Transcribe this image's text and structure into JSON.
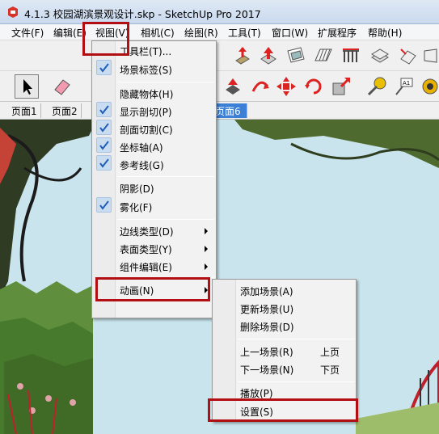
{
  "window": {
    "title": "4.1.3 校园湖滨景观设计.skp - SketchUp Pro 2017"
  },
  "menubar": {
    "items": [
      {
        "label": "文件(F)"
      },
      {
        "label": "编辑(E)"
      },
      {
        "label": "视图(V)"
      },
      {
        "label": "相机(C)"
      },
      {
        "label": "绘图(R)"
      },
      {
        "label": "工具(T)"
      },
      {
        "label": "窗口(W)"
      },
      {
        "label": "扩展程序"
      },
      {
        "label": "帮助(H)"
      }
    ]
  },
  "tabs": {
    "items": [
      "页面1",
      "页面2",
      "页面6"
    ]
  },
  "view_menu": {
    "items": [
      {
        "label": "工具栏(T)...",
        "checked": false
      },
      {
        "label": "场景标签(S)",
        "checked": true
      },
      {
        "label": "隐藏物体(H)",
        "checked": false
      },
      {
        "label": "显示剖切(P)",
        "checked": true
      },
      {
        "label": "剖面切割(C)",
        "checked": true
      },
      {
        "label": "坐标轴(A)",
        "checked": true
      },
      {
        "label": "参考线(G)",
        "checked": true
      },
      {
        "label": "阴影(D)",
        "checked": false
      },
      {
        "label": "雾化(F)",
        "checked": true
      },
      {
        "label": "边线类型(D)",
        "submenu": true
      },
      {
        "label": "表面类型(Y)",
        "submenu": true
      },
      {
        "label": "组件编辑(E)",
        "submenu": true
      },
      {
        "label": "动画(N)",
        "submenu": true
      }
    ]
  },
  "animation_submenu": {
    "items": [
      {
        "label": "添加场景(A)",
        "shortcut": ""
      },
      {
        "label": "更新场景(U)",
        "shortcut": ""
      },
      {
        "label": "删除场景(D)",
        "shortcut": ""
      },
      {
        "label": "上一场景(R)",
        "shortcut": "上页"
      },
      {
        "label": "下一场景(N)",
        "shortcut": "下页"
      },
      {
        "label": "播放(P)",
        "shortcut": ""
      },
      {
        "label": "设置(S)",
        "shortcut": ""
      }
    ]
  },
  "colors": {
    "highlight": "#b10f14",
    "active_tab": "#3b7fd6",
    "checkmark": "#1f5fb8"
  }
}
